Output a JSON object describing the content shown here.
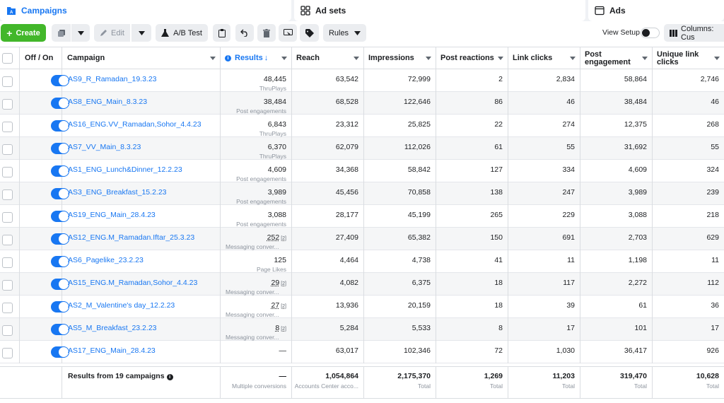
{
  "tabs": {
    "campaigns": "Campaigns",
    "ad_sets": "Ad sets",
    "ads": "Ads"
  },
  "toolbar": {
    "create": "Create",
    "edit": "Edit",
    "ab_test": "A/B Test",
    "rules": "Rules",
    "view_setup": "View Setup",
    "columns": "Columns: Cus"
  },
  "headers": {
    "off_on": "Off / On",
    "campaign": "Campaign",
    "results": "Results",
    "reach": "Reach",
    "impressions": "Impressions",
    "post_reactions": "Post reactions",
    "link_clicks": "Link clicks",
    "post_engagement": "Post engagement",
    "unique_link_clicks": "Unique link clicks"
  },
  "rows": [
    {
      "name": "AS9_R_Ramadan_19.3.23",
      "result": "48,445",
      "result_type": "ThruPlays",
      "reach": "63,542",
      "impressions": "72,999",
      "reactions": "2",
      "link_clicks": "2,834",
      "engagement": "58,864",
      "unique_clicks": "2,746"
    },
    {
      "name": "AS8_ENG_Main_8.3.23",
      "result": "38,484",
      "result_type": "Post engagements",
      "reach": "68,528",
      "impressions": "122,646",
      "reactions": "86",
      "link_clicks": "46",
      "engagement": "38,484",
      "unique_clicks": "46"
    },
    {
      "name": "AS16_ENG.VV_Ramadan,Sohor_4.4.23",
      "result": "6,843",
      "result_type": "ThruPlays",
      "reach": "23,312",
      "impressions": "25,825",
      "reactions": "22",
      "link_clicks": "274",
      "engagement": "12,375",
      "unique_clicks": "268"
    },
    {
      "name": "AS7_VV_Main_8.3.23",
      "result": "6,370",
      "result_type": "ThruPlays",
      "reach": "62,079",
      "impressions": "112,026",
      "reactions": "61",
      "link_clicks": "55",
      "engagement": "31,692",
      "unique_clicks": "55"
    },
    {
      "name": "AS1_ENG_Lunch&Dinner_12.2.23",
      "result": "4,609",
      "result_type": "Post engagements",
      "reach": "34,368",
      "impressions": "58,842",
      "reactions": "127",
      "link_clicks": "334",
      "engagement": "4,609",
      "unique_clicks": "324"
    },
    {
      "name": "AS3_ENG_Breakfast_15.2.23",
      "result": "3,989",
      "result_type": "Post engagements",
      "reach": "45,456",
      "impressions": "70,858",
      "reactions": "138",
      "link_clicks": "247",
      "engagement": "3,989",
      "unique_clicks": "239"
    },
    {
      "name": "AS19_ENG_Main_28.4.23",
      "result": "3,088",
      "result_type": "Post engagements",
      "reach": "28,177",
      "impressions": "45,199",
      "reactions": "265",
      "link_clicks": "229",
      "engagement": "3,088",
      "unique_clicks": "218"
    },
    {
      "name": "AS12_ENG.M_Ramadan.Iftar_25.3.23",
      "result": "252",
      "result_type": "Messaging conver...",
      "ext": "[2]",
      "reach": "27,409",
      "impressions": "65,382",
      "reactions": "150",
      "link_clicks": "691",
      "engagement": "2,703",
      "unique_clicks": "629"
    },
    {
      "name": "AS6_Pagelike_23.2.23",
      "result": "125",
      "result_type": "Page Likes",
      "reach": "4,464",
      "impressions": "4,738",
      "reactions": "41",
      "link_clicks": "11",
      "engagement": "1,198",
      "unique_clicks": "11"
    },
    {
      "name": "AS15_ENG.M_Ramadan,Sohor_4.4.23",
      "result": "29",
      "result_type": "Messaging conver...",
      "ext": "[2]",
      "reach": "4,082",
      "impressions": "6,375",
      "reactions": "18",
      "link_clicks": "117",
      "engagement": "2,272",
      "unique_clicks": "112"
    },
    {
      "name": "AS2_M_Valentine's day_12.2.23",
      "result": "27",
      "result_type": "Messaging conver...",
      "ext": "[2]",
      "reach": "13,936",
      "impressions": "20,159",
      "reactions": "18",
      "link_clicks": "39",
      "engagement": "61",
      "unique_clicks": "36"
    },
    {
      "name": "AS5_M_Breakfast_23.2.23",
      "result": "8",
      "result_type": "Messaging conver...",
      "ext": "[2]",
      "reach": "5,284",
      "impressions": "5,533",
      "reactions": "8",
      "link_clicks": "17",
      "engagement": "101",
      "unique_clicks": "17"
    },
    {
      "name": "AS17_ENG_Main_28.4.23",
      "result": "—",
      "result_type": "",
      "reach": "63,017",
      "impressions": "102,346",
      "reactions": "72",
      "link_clicks": "1,030",
      "engagement": "36,417",
      "unique_clicks": "926"
    }
  ],
  "footer": {
    "label": "Results from 19 campaigns",
    "result": "—",
    "result_sub": "Multiple conversions",
    "reach": "1,054,864",
    "reach_sub": "Accounts Center acco...",
    "impressions": "2,175,370",
    "impressions_sub": "Total",
    "reactions": "1,269",
    "reactions_sub": "Total",
    "link_clicks": "11,203",
    "link_clicks_sub": "Total",
    "engagement": "319,470",
    "engagement_sub": "Total",
    "unique_clicks": "10,628",
    "unique_clicks_sub": "Total"
  },
  "colors": {
    "accent": "#1877f2",
    "create": "#42b72a"
  }
}
